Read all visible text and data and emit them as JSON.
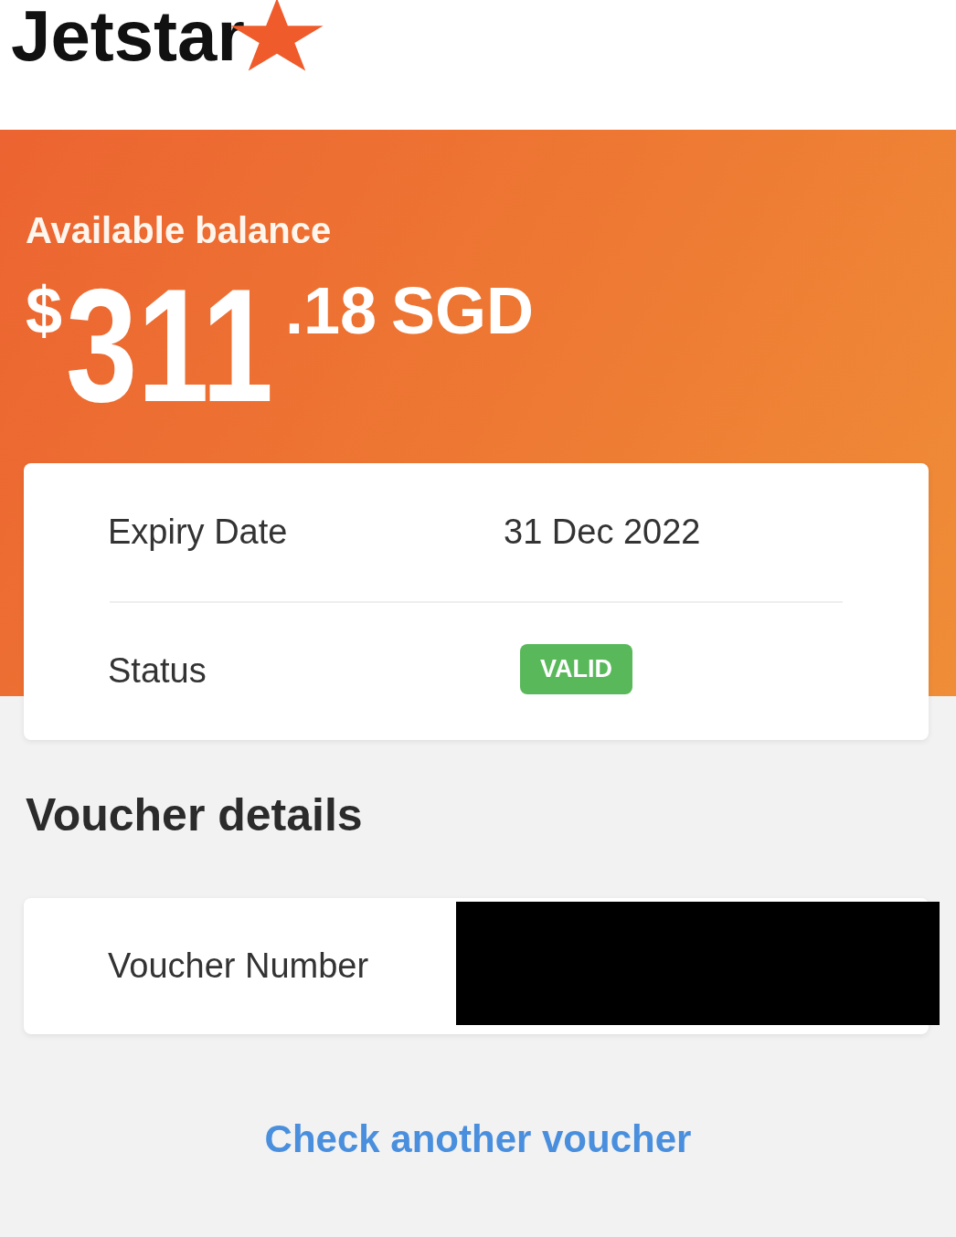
{
  "header": {
    "logo_text": "Jetstar"
  },
  "balance": {
    "label": "Available balance",
    "currency_symbol": "$",
    "whole": "311",
    "cents": ".18",
    "currency": "SGD"
  },
  "summary": {
    "rows": [
      {
        "kind": "text",
        "label": "Expiry Date",
        "value": "31 Dec 2022"
      },
      {
        "kind": "badge",
        "label": "Status",
        "value": "VALID"
      }
    ]
  },
  "voucher_details": {
    "title": "Voucher details",
    "rows": [
      {
        "label": "Voucher Number",
        "redacted": true
      }
    ]
  },
  "link": {
    "label": "Check another voucher"
  }
}
